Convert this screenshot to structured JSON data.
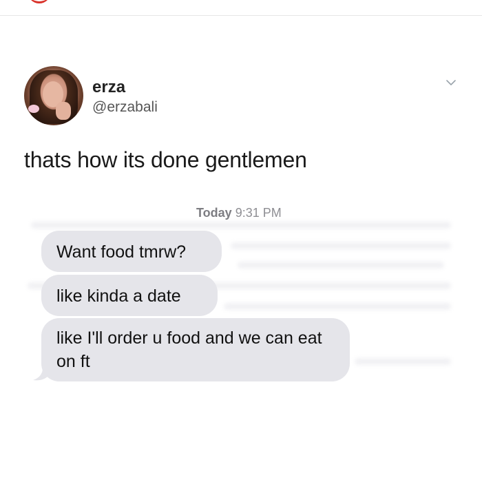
{
  "tweet": {
    "display_name": "erza",
    "handle": "@erzabali",
    "text": "thats how its done gentlemen"
  },
  "conversation": {
    "timestamp_day": "Today",
    "timestamp_time": "9:31 PM",
    "messages": [
      "Want food tmrw?",
      "like kinda a date",
      "like I'll order u food and we can eat on ft"
    ],
    "bubble_color": "#e5e5ea"
  },
  "icons": {
    "menu": "chevron-down-icon",
    "avatar": "profile-photo"
  },
  "colors": {
    "accent_top": "#d9332b",
    "name_text": "#222222",
    "handle_text": "#555555",
    "timestamp_text": "#8e8e93"
  }
}
